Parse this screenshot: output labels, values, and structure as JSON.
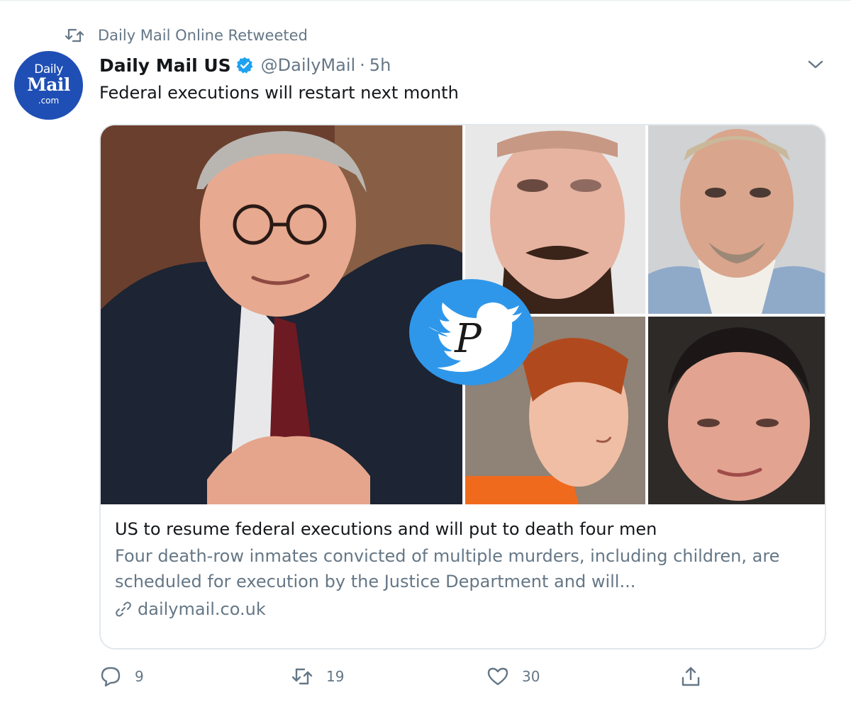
{
  "retweet": {
    "label": "Daily Mail Online Retweeted"
  },
  "avatar": {
    "line1": "Daily",
    "line2": "Mail",
    "line3": ".com"
  },
  "tweet": {
    "display_name": "Daily Mail US",
    "handle": "@DailyMail",
    "separator": "·",
    "time": "5h",
    "text": "Federal executions will restart next month"
  },
  "card": {
    "title": "US to resume federal executions and will put to death four men",
    "description": "Four death-row inmates convicted of multiple murders, including children, are scheduled for execution by the Justice Department and will...",
    "domain": "dailymail.co.uk",
    "watermark_letter": "P"
  },
  "actions": {
    "reply_count": "9",
    "retweet_count": "19",
    "like_count": "30"
  },
  "icons": {
    "retweet": "retweet-icon",
    "verified": "verified-badge-icon",
    "caret": "chevron-down-icon",
    "link": "link-icon",
    "reply": "reply-icon",
    "like": "heart-icon",
    "share": "share-icon"
  },
  "colors": {
    "accent": "#1da1f2",
    "muted_text": "#657786",
    "avatar_bg": "#1f4fb4"
  }
}
